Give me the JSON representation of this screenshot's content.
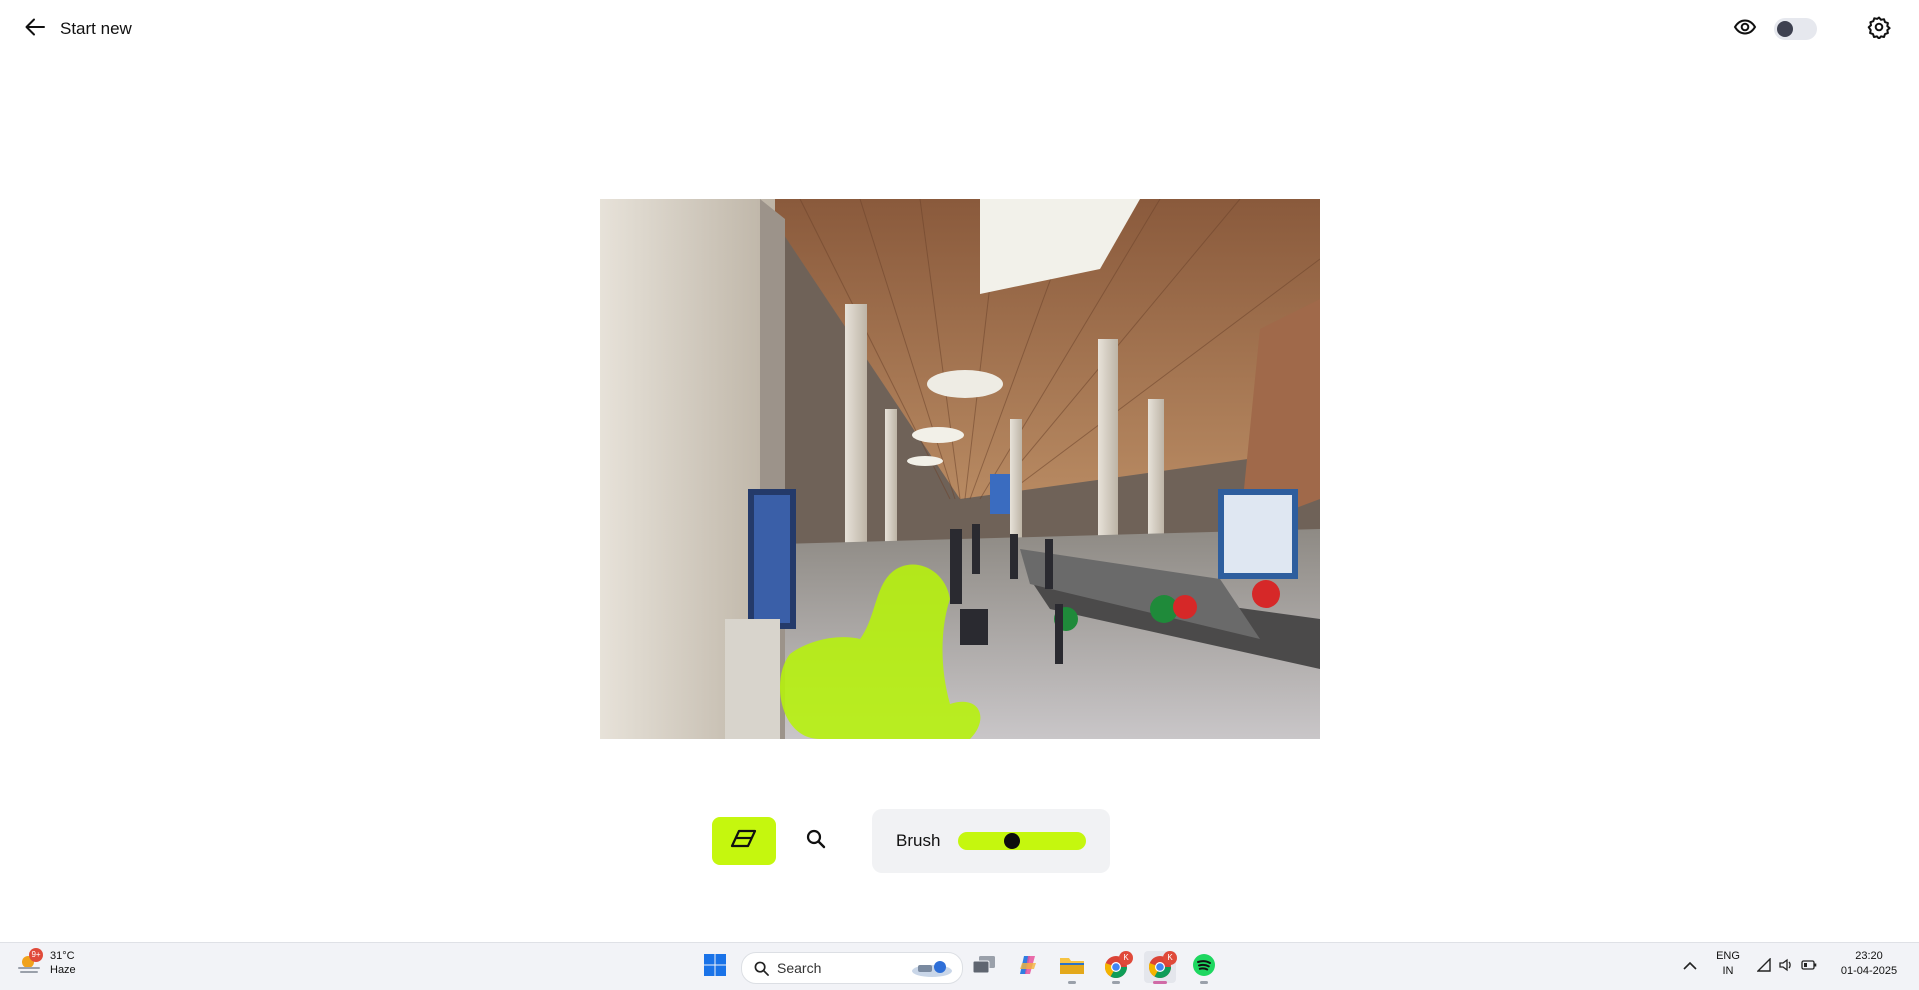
{
  "header": {
    "back_label": "Start new",
    "preview_toggle_on": false
  },
  "toolbar": {
    "brush_label": "Brush",
    "brush_size": 0.25
  },
  "taskbar": {
    "weather_temp": "31°C",
    "weather_desc": "Haze",
    "weather_badge": "9+",
    "search_label": "Search",
    "chrome_badge": "K",
    "chrome2_badge": "K",
    "lang_top": "ENG",
    "lang_bottom": "IN",
    "time": "23:20",
    "date": "01-04-2025"
  },
  "colors": {
    "accent": "#c5f70e",
    "mask": "#b6f20a"
  }
}
